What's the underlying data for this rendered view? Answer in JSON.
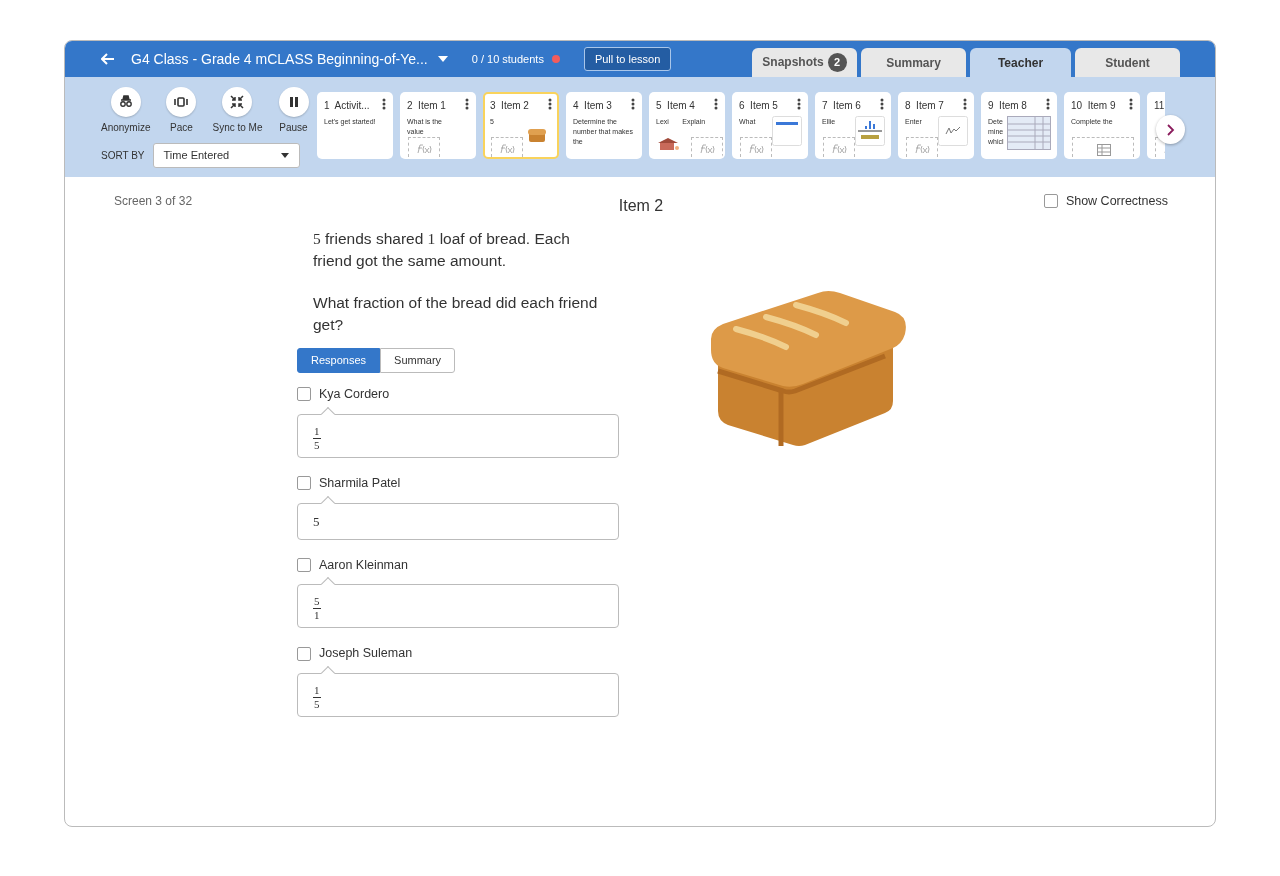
{
  "header": {
    "title": "G4 Class - Grade 4 mCLASS Beginning-of-Ye...",
    "students": "0 / 10 students",
    "live": false,
    "pull_button": "Pull to lesson"
  },
  "tabs": [
    {
      "label": "Snapshots",
      "badge": "2",
      "selected": false
    },
    {
      "label": "Summary",
      "selected": false
    },
    {
      "label": "Teacher",
      "selected": true
    },
    {
      "label": "Student",
      "selected": false
    }
  ],
  "controls": [
    {
      "kind": "anonymize",
      "label": "Anonymize"
    },
    {
      "kind": "pace",
      "label": "Pace"
    },
    {
      "kind": "sync",
      "label": "Sync to Me"
    },
    {
      "kind": "pause",
      "label": "Pause"
    }
  ],
  "sort": {
    "label": "SORT BY",
    "value": "Time Entered"
  },
  "screens": [
    {
      "number": "1",
      "title": "Activit...",
      "text": "Let's get started!",
      "kind": "text",
      "selected": false
    },
    {
      "number": "2",
      "title": "Item 1",
      "text": "What is the value",
      "kind": "fx",
      "selected": false
    },
    {
      "number": "3",
      "title": "Item 2",
      "text": "5",
      "kind": "bread",
      "selected": true
    },
    {
      "number": "4",
      "title": "Item 3",
      "text": "Determine the number that makes the",
      "kind": "text",
      "selected": false
    },
    {
      "number": "5",
      "title": "Item 4",
      "text": "Lexi",
      "text_2": "Explain",
      "kind": "house",
      "selected": false
    },
    {
      "number": "6",
      "title": "Item 5",
      "text": "What",
      "kind": "numberline",
      "selected": false
    },
    {
      "number": "7",
      "title": "Item 6",
      "text": "Ellie",
      "kind": "dotplot",
      "selected": false
    },
    {
      "number": "8",
      "title": "Item 7",
      "text": "Enter",
      "kind": "sketch",
      "selected": false
    },
    {
      "number": "9",
      "title": "Item 8",
      "text": "Dete mine whicl",
      "kind": "grid",
      "selected": false
    },
    {
      "number": "10",
      "title": "Item 9",
      "text": "Complete the",
      "kind": "table",
      "selected": false
    },
    {
      "number": "11",
      "kind": "fx",
      "selected": false
    }
  ],
  "screen_counter": "Screen 3 of 32",
  "item_title": "Item 2",
  "show_correctness": {
    "label": "Show Correctness",
    "checked": false
  },
  "question": {
    "parts": [
      {
        "kind": "math",
        "text": "5"
      },
      {
        "kind": "text",
        "text": " friends shared "
      },
      {
        "kind": "math",
        "text": "1"
      },
      {
        "kind": "text",
        "text": " loaf of bread. Each friend got the same amount."
      }
    ],
    "prompt": "What fraction of the bread did each friend get?"
  },
  "view_toggle": [
    {
      "label": "Responses",
      "selected": true
    },
    {
      "label": "Summary",
      "selected": false
    }
  ],
  "responses": [
    {
      "student": "Kya Cordero",
      "checked": false,
      "answer": {
        "kind": "fraction",
        "numerator": "1",
        "denominator": "5"
      }
    },
    {
      "student": "Sharmila Patel",
      "checked": false,
      "answer": {
        "kind": "number",
        "value": "5"
      }
    },
    {
      "student": "Aaron Kleinman",
      "checked": false,
      "answer": {
        "kind": "fraction",
        "numerator": "5",
        "denominator": "1"
      }
    },
    {
      "student": "Joseph Suleman",
      "checked": false,
      "answer": {
        "kind": "fraction",
        "numerator": "1",
        "denominator": "5"
      }
    }
  ]
}
